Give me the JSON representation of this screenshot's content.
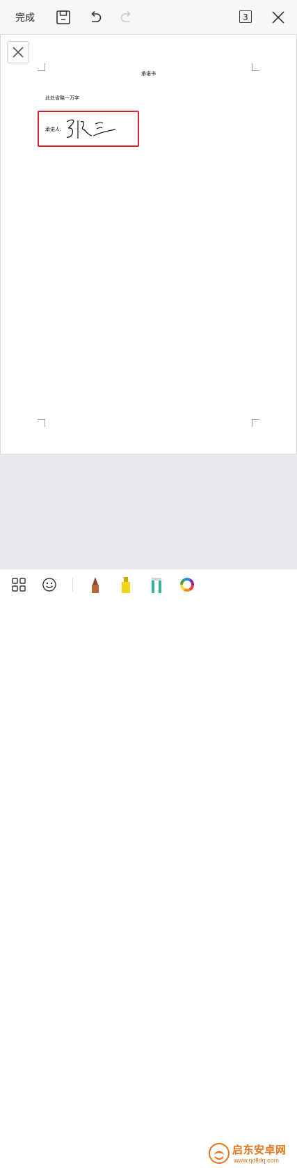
{
  "toolbar": {
    "done_label": "完成",
    "page_count": "3",
    "icons": [
      "save-icon",
      "undo-icon",
      "redo-icon",
      "close-icon"
    ]
  },
  "document": {
    "title": "承诺书",
    "body_text": "此处省略一万字",
    "signer_label": "承诺人:",
    "signature_text": "张三",
    "highlight_color": "#e0212b"
  },
  "bottom_tools": {
    "icons": [
      "grid-icon",
      "emoji-icon",
      "pen-icon",
      "highlighter-icon",
      "eraser-icon",
      "color-wheel-icon"
    ],
    "pen_color": "#b5683a",
    "highlighter_color": "#f2d21b",
    "eraser_color": "#3bb0a0"
  },
  "watermark": {
    "text": "启东安卓网",
    "url": "www.qdlldq.com"
  }
}
